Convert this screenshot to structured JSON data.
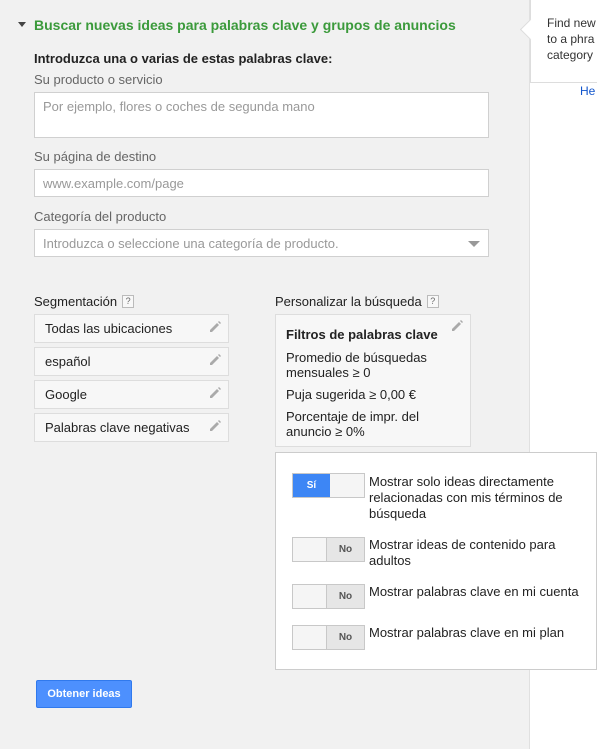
{
  "section": {
    "title": "Buscar nuevas ideas para palabras clave y grupos de anuncios",
    "intro": "Introduzca una o varias de estas palabras clave:"
  },
  "product": {
    "label": "Su producto o servicio",
    "placeholder": "Por ejemplo, flores o coches de segunda mano"
  },
  "landing": {
    "label": "Su página de destino",
    "placeholder": "www.example.com/page"
  },
  "category": {
    "label": "Categoría del producto",
    "placeholder": "Introduzca o seleccione una categoría de producto."
  },
  "targeting": {
    "label": "Segmentación",
    "help": "?",
    "items": [
      {
        "label": "Todas las ubicaciones"
      },
      {
        "label": "español"
      },
      {
        "label": "Google"
      },
      {
        "label": "Palabras clave negativas"
      }
    ]
  },
  "customize": {
    "label": "Personalizar la búsqueda",
    "help": "?",
    "filter_title": "Filtros de palabras clave",
    "filters": [
      "Promedio de búsquedas mensuales ≥ 0",
      "Puja sugerida ≥ 0,00 €",
      "Porcentaje de impr. del anuncio ≥ 0%"
    ]
  },
  "options": [
    {
      "state": "Sí",
      "on": true,
      "label": "Mostrar solo ideas directamente relacionadas con mis términos de búsqueda"
    },
    {
      "state": "No",
      "on": false,
      "label": "Mostrar ideas de contenido para adultos"
    },
    {
      "state": "No",
      "on": false,
      "label": "Mostrar palabras clave en mi cuenta"
    },
    {
      "state": "No",
      "on": false,
      "label": "Mostrar palabras clave en mi plan"
    }
  ],
  "actions": {
    "get_ideas": "Obtener ideas"
  },
  "tooltip": {
    "lines": [
      "Find new",
      "to a phra",
      "category"
    ],
    "help_link": "He"
  },
  "colors": {
    "header_green": "#3b9a3b",
    "button_blue": "#4d90fe",
    "toggle_on_blue": "#3d86f5",
    "link_blue": "#1155cc"
  }
}
